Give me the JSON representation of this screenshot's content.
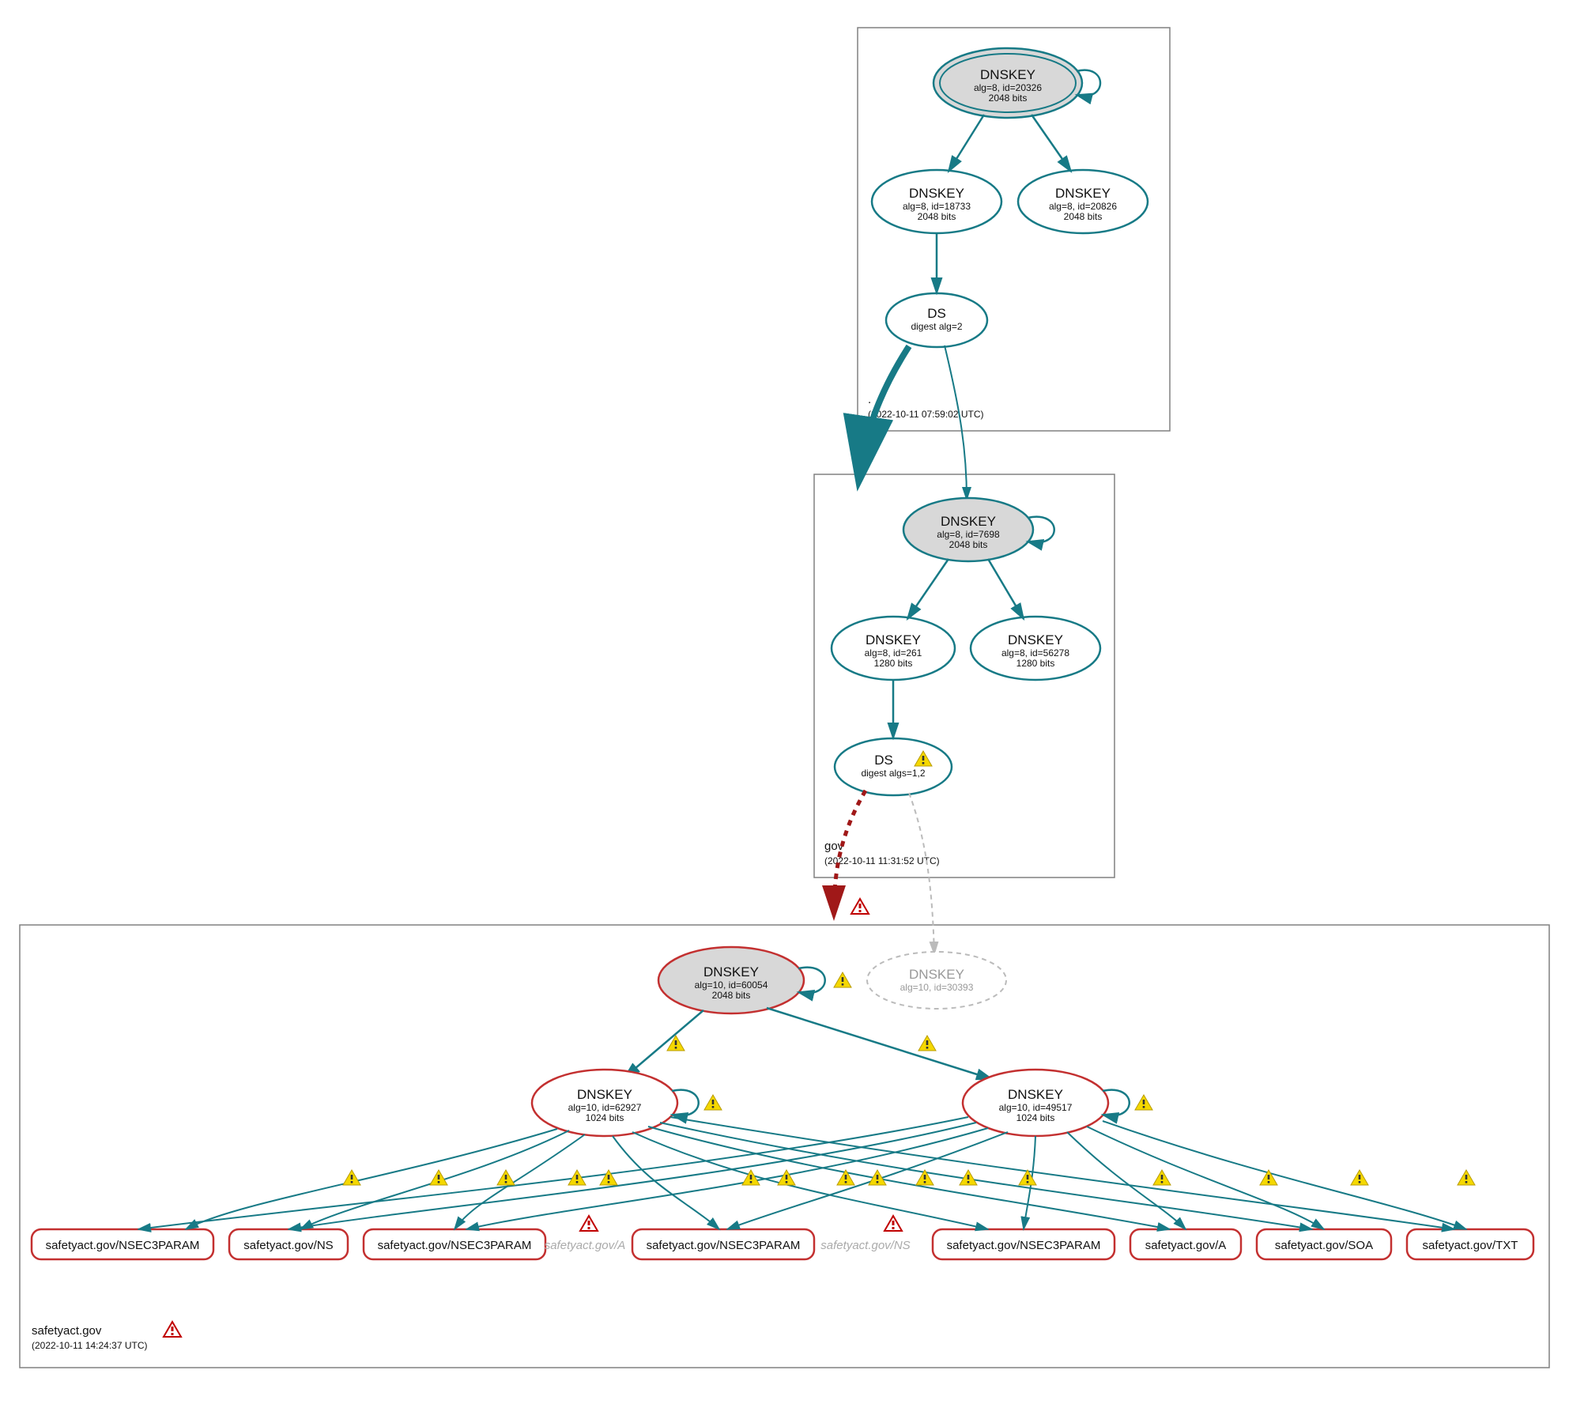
{
  "zones": {
    "root": {
      "label": ".",
      "ts": "(2022-10-11 07:59:02 UTC)"
    },
    "gov": {
      "label": "gov",
      "ts": "(2022-10-11 11:31:52 UTC)"
    },
    "safetyact": {
      "label": "safetyact.gov",
      "ts": "(2022-10-11 14:24:37 UTC)"
    }
  },
  "root_ksk": {
    "title": "DNSKEY",
    "line1": "alg=8, id=20326",
    "line2": "2048 bits"
  },
  "root_zsk1": {
    "title": "DNSKEY",
    "line1": "alg=8, id=18733",
    "line2": "2048 bits"
  },
  "root_zsk2": {
    "title": "DNSKEY",
    "line1": "alg=8, id=20826",
    "line2": "2048 bits"
  },
  "root_ds": {
    "title": "DS",
    "line1": "digest alg=2"
  },
  "gov_ksk": {
    "title": "DNSKEY",
    "line1": "alg=8, id=7698",
    "line2": "2048 bits"
  },
  "gov_zsk1": {
    "title": "DNSKEY",
    "line1": "alg=8, id=261",
    "line2": "1280 bits"
  },
  "gov_zsk2": {
    "title": "DNSKEY",
    "line1": "alg=8, id=56278",
    "line2": "1280 bits"
  },
  "gov_ds": {
    "title": "DS",
    "line1": "digest algs=1,2"
  },
  "sa_ksk": {
    "title": "DNSKEY",
    "line1": "alg=10, id=60054",
    "line2": "2048 bits"
  },
  "sa_ghost": {
    "title": "DNSKEY",
    "line1": "alg=10, id=30393"
  },
  "sa_zsk1": {
    "title": "DNSKEY",
    "line1": "alg=10, id=62927",
    "line2": "1024 bits"
  },
  "sa_zsk2": {
    "title": "DNSKEY",
    "line1": "alg=10, id=49517",
    "line2": "1024 bits"
  },
  "rr": {
    "r1": "safetyact.gov/NSEC3PARAM",
    "r2": "safetyact.gov/NS",
    "r3": "safetyact.gov/NSEC3PARAM",
    "r4": "safetyact.gov/A",
    "r5": "safetyact.gov/NSEC3PARAM",
    "r6": "safetyact.gov/NS",
    "r7": "safetyact.gov/NSEC3PARAM",
    "r8": "safetyact.gov/A",
    "r9": "safetyact.gov/SOA",
    "r10": "safetyact.gov/TXT"
  }
}
